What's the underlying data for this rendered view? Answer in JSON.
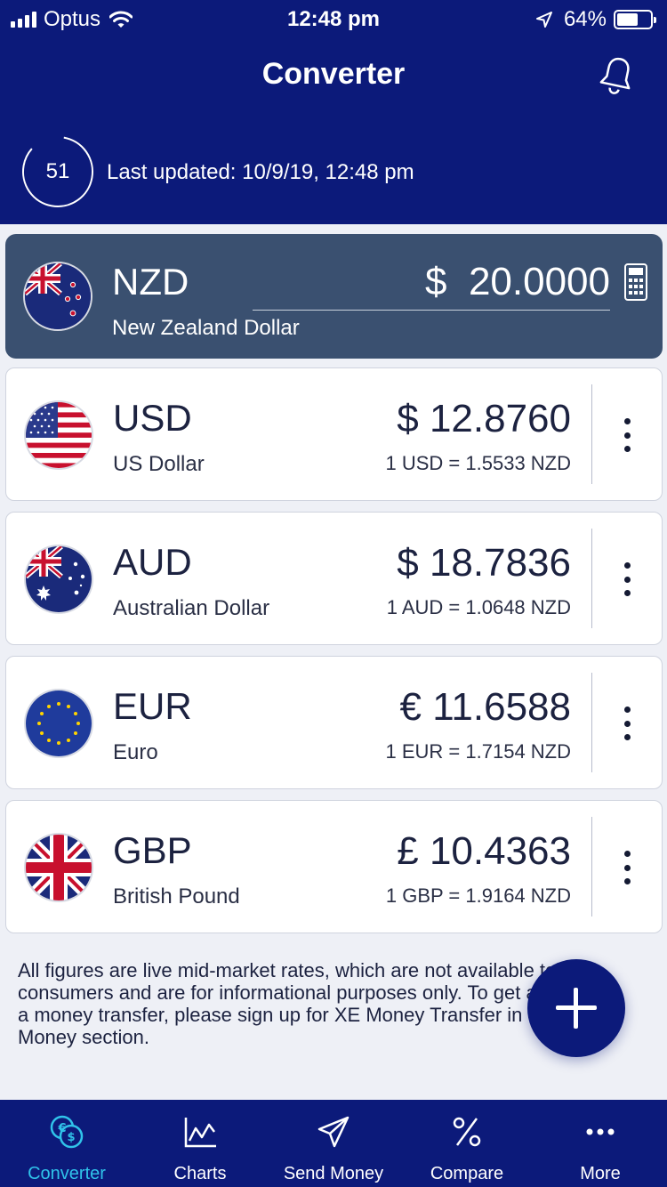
{
  "status_bar": {
    "carrier": "Optus",
    "time": "12:48 pm",
    "battery_percent_label": "64%",
    "battery_level": 0.64
  },
  "header": {
    "title": "Converter",
    "timer_value": "51",
    "last_updated": "Last updated: 10/9/19, 12:48 pm",
    "icons": {
      "notifications": "bell-icon"
    }
  },
  "base_currency": {
    "code": "NZD",
    "name": "New Zealand Dollar",
    "amount": "$  20.0000",
    "flag": "nz-flag-icon",
    "accessory_icon": "calculator-icon"
  },
  "currencies": [
    {
      "code": "USD",
      "name": "US Dollar",
      "amount": "$ 12.8760",
      "rate": "1 USD = 1.5533 NZD",
      "flag": "us-flag-icon"
    },
    {
      "code": "AUD",
      "name": "Australian Dollar",
      "amount": "$ 18.7836",
      "rate": "1 AUD = 1.0648 NZD",
      "flag": "au-flag-icon"
    },
    {
      "code": "EUR",
      "name": "Euro",
      "amount": "€ 11.6588",
      "rate": "1 EUR = 1.7154 NZD",
      "flag": "eu-flag-icon"
    },
    {
      "code": "GBP",
      "name": "British Pound",
      "amount": "£ 10.4363",
      "rate": "1 GBP = 1.9164 NZD",
      "flag": "gb-flag-icon"
    }
  ],
  "disclaimer": "All figures are live mid-market rates, which are not available to consumers and are for informational purposes only. To get a quote for a money transfer, please sign up for XE Money Transfer in the Send Money section.",
  "tabs": [
    {
      "label": "Converter",
      "icon": "converter-icon",
      "active": true
    },
    {
      "label": "Charts",
      "icon": "chart-icon",
      "active": false
    },
    {
      "label": "Send Money",
      "icon": "send-icon",
      "active": false
    },
    {
      "label": "Compare",
      "icon": "percent-icon",
      "active": false
    },
    {
      "label": "More",
      "icon": "more-icon",
      "active": false
    }
  ],
  "colors": {
    "header_bg": "#0c1a7a",
    "base_card_bg": "#3a5070",
    "tab_active": "#30c3ea",
    "page_bg": "#eef0f6"
  }
}
